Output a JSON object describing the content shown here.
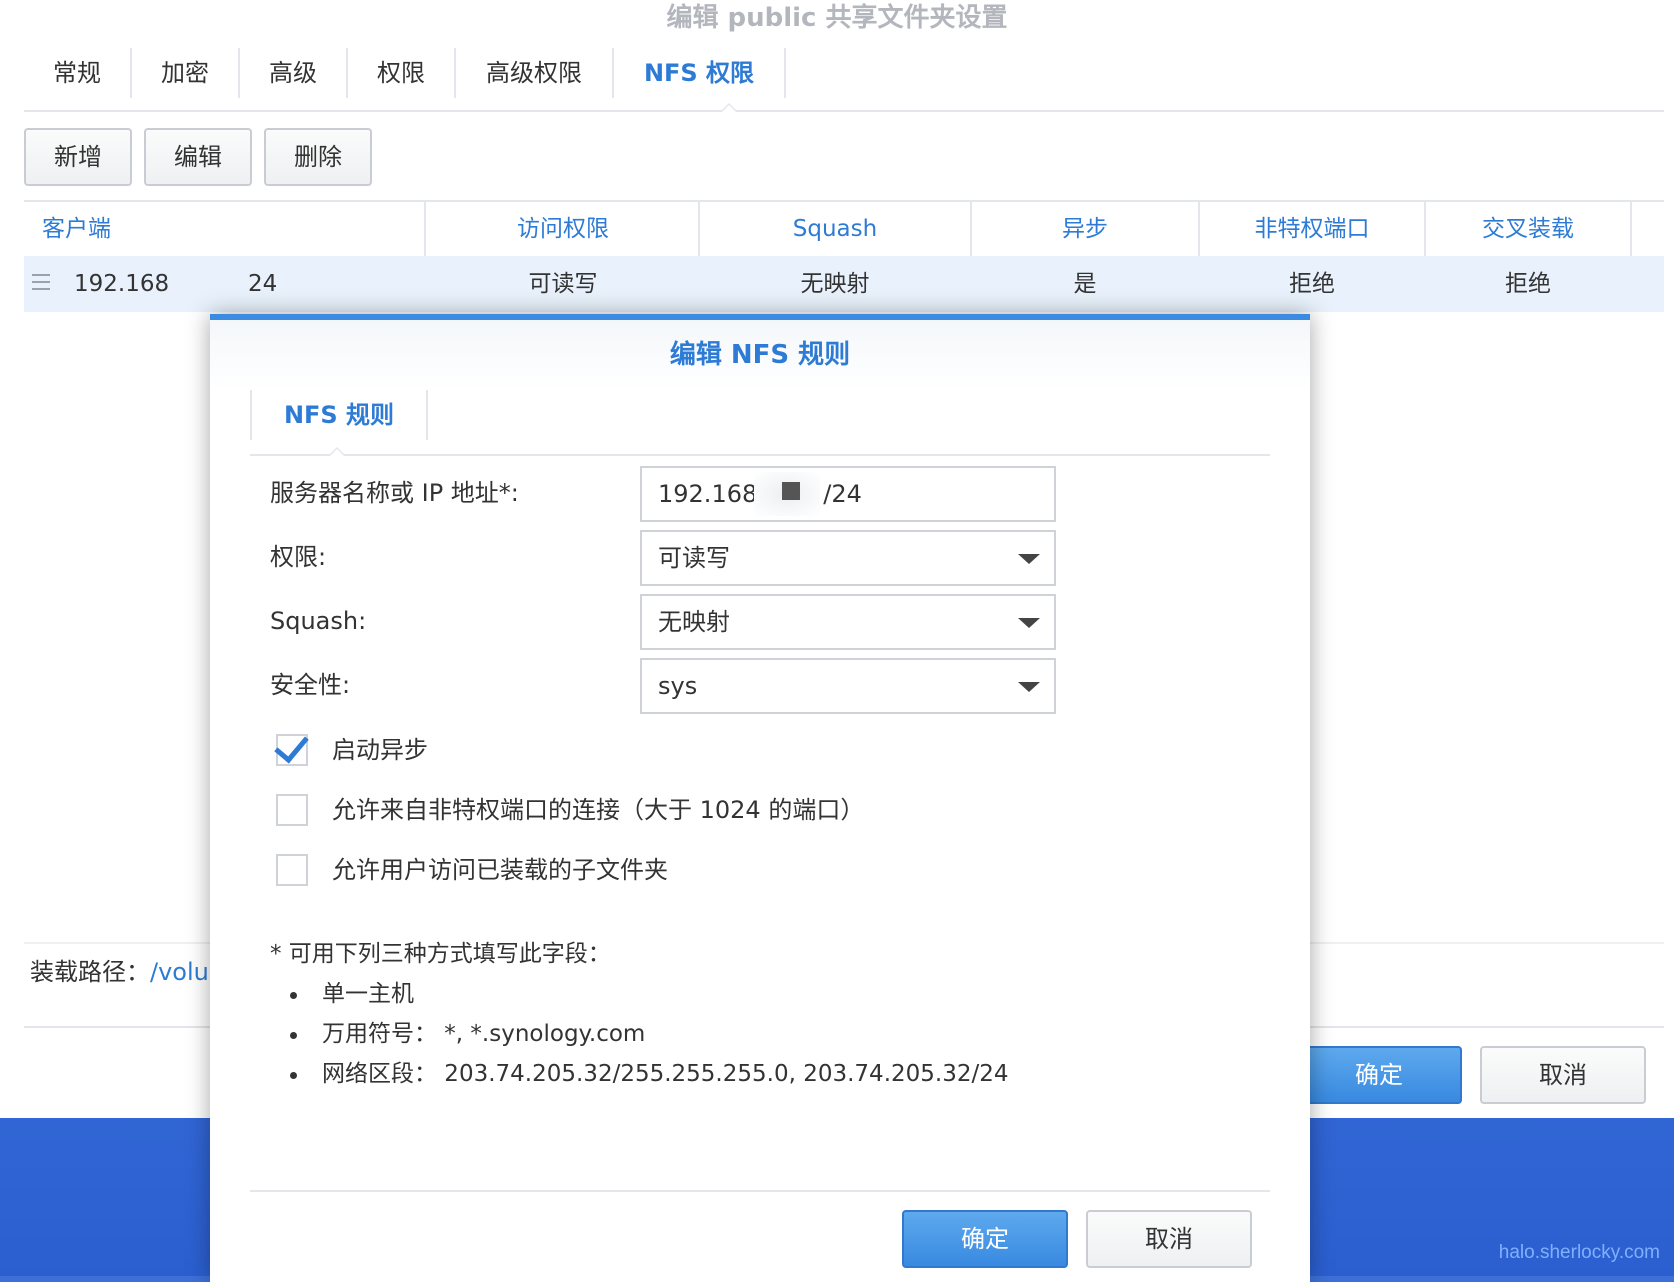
{
  "window": {
    "title": "编辑 public 共享文件夹设置",
    "tabs": [
      "常规",
      "加密",
      "高级",
      "权限",
      "高级权限",
      "NFS 权限"
    ],
    "active_tab": "NFS 权限",
    "toolbar": {
      "add": "新增",
      "edit": "编辑",
      "delete": "删除"
    },
    "table": {
      "headers": [
        "客户端",
        "访问权限",
        "Squash",
        "异步",
        "非特权端口",
        "交叉装载"
      ],
      "rows": [
        {
          "client_a": "192.168",
          "client_b": "24",
          "access": "可读写",
          "squash": "无映射",
          "async": "是",
          "nonpriv": "拒绝",
          "crossmnt": "拒绝"
        }
      ]
    },
    "mount_path_label": "装载路径：",
    "mount_path_value": "/volu",
    "ok": "确定",
    "cancel": "取消"
  },
  "dialog": {
    "title": "编辑 NFS 规则",
    "tab": "NFS 规则",
    "fields": {
      "host_label": "服务器名称或 IP 地址*:",
      "host_value_a": "192.168",
      "host_value_b": "/24",
      "privilege_label": "权限:",
      "privilege_value": "可读写",
      "squash_label": "Squash:",
      "squash_value": "无映射",
      "security_label": "安全性:",
      "security_value": "sys"
    },
    "checkboxes": [
      {
        "label": "启动异步",
        "checked": true
      },
      {
        "label": "允许来自非特权端口的连接（大于 1024 的端口）",
        "checked": false
      },
      {
        "label": "允许用户访问已装载的子文件夹",
        "checked": false
      }
    ],
    "note": {
      "intro": "* 可用下列三种方式填写此字段：",
      "items": [
        "单一主机",
        "万用符号：  *, *.synology.com",
        "网络区段：  203.74.205.32/255.255.255.0, 203.74.205.32/24"
      ]
    },
    "ok": "确定",
    "cancel": "取消"
  },
  "watermark": "halo.sherlocky.com",
  "colors": {
    "accent": "#2d7bd4",
    "primary_button": "#3889e0",
    "desktop": "#3d6fd6",
    "row_selected": "#e9f2fc"
  }
}
